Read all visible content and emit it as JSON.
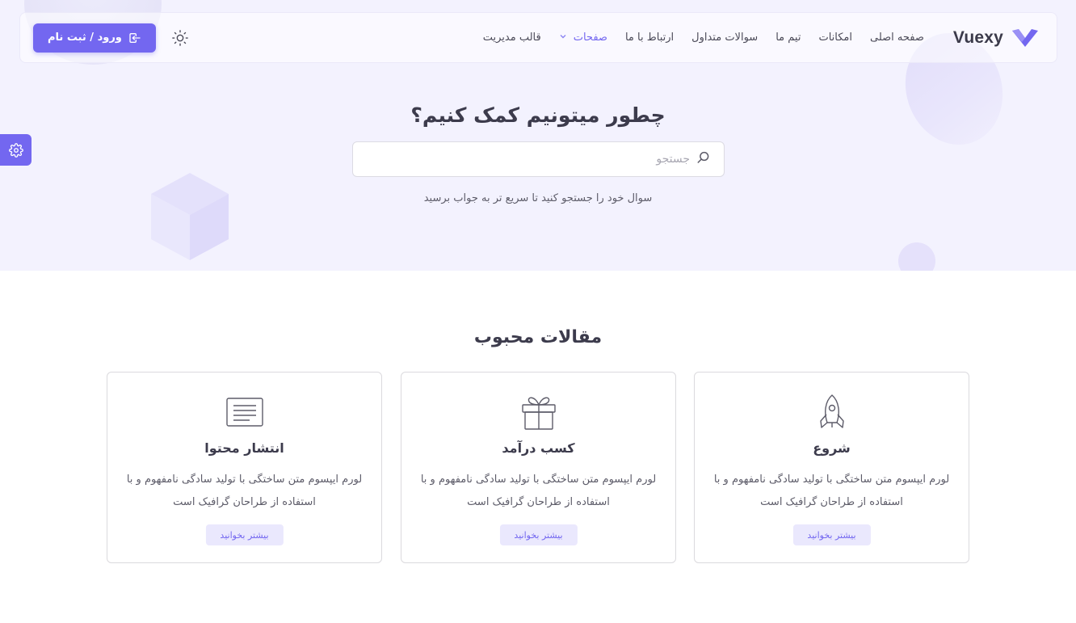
{
  "colors": {
    "primary": "#7367f0",
    "hero_bg": "#f3f2fe",
    "heading": "#3c3b4c",
    "text": "#5d5c69"
  },
  "navbar": {
    "brand": "Vuexy",
    "items": [
      {
        "label": "صفحه اصلی",
        "active": false
      },
      {
        "label": "امکانات",
        "active": false
      },
      {
        "label": "تیم ما",
        "active": false
      },
      {
        "label": "سوالات متداول",
        "active": false
      },
      {
        "label": "ارتباط با ما",
        "active": false
      },
      {
        "label": "صفحات",
        "active": true,
        "dropdown": true
      },
      {
        "label": "قالب مدیریت",
        "active": false
      }
    ],
    "theme_icon": "sun-icon",
    "login_label": "ورود / ثبت نام",
    "login_icon": "login-icon"
  },
  "customizer_icon": "gear-icon",
  "hero": {
    "title": "چطور میتونیم کمک کنیم؟",
    "search_placeholder": "جستجو",
    "search_icon": "search-icon",
    "subtitle": "سوال خود را جستجو کنید تا سریع تر به جواب برسید"
  },
  "articles": {
    "title": "مقالات محبوب",
    "cards": [
      {
        "icon": "rocket-icon",
        "title": "شروع",
        "text": "لورم ایپسوم متن ساختگی با تولید سادگی نامفهوم و با استفاده از طراحان گرافیک است",
        "button": "بیشتر بخوانید"
      },
      {
        "icon": "gift-icon",
        "title": "کسب درآمد",
        "text": "لورم ایپسوم متن ساختگی با تولید سادگی نامفهوم و با استفاده از طراحان گرافیک است",
        "button": "بیشتر بخوانید"
      },
      {
        "icon": "document-icon",
        "title": "انتشار محتوا",
        "text": "لورم ایپسوم متن ساختگی با تولید سادگی نامفهوم و با استفاده از طراحان گرافیک است",
        "button": "بیشتر بخوانید"
      }
    ]
  }
}
